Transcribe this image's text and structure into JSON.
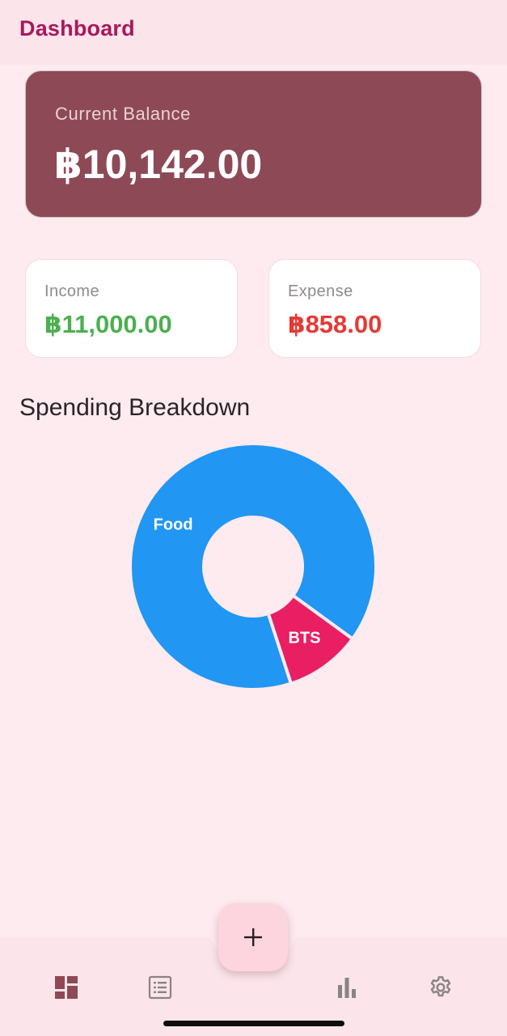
{
  "app_bar": {
    "title": "Dashboard"
  },
  "balance": {
    "label": "Current Balance",
    "amount": "฿10,142.00"
  },
  "income": {
    "label": "Income",
    "amount": "฿11,000.00"
  },
  "expense": {
    "label": "Expense",
    "amount": "฿858.00"
  },
  "spending": {
    "title": "Spending Breakdown"
  },
  "chart_data": {
    "type": "pie",
    "donut": true,
    "slices": [
      {
        "label": "Food",
        "fraction": 0.9,
        "color": "#2196f3"
      },
      {
        "label": "BTS",
        "fraction": 0.1,
        "color": "#e91e63"
      }
    ]
  },
  "colors": {
    "brand": "#a8195b",
    "balance_card": "#8e4956",
    "income": "#4caf50",
    "expense": "#e53935",
    "background": "#fdebf0"
  },
  "bottom_nav": {
    "items": [
      {
        "icon": "dashboard-icon",
        "active": true
      },
      {
        "icon": "transactions-list-icon",
        "active": false
      },
      {
        "icon": "bar-chart-icon",
        "active": false
      },
      {
        "icon": "settings-gear-icon",
        "active": false
      }
    ],
    "fab_icon": "plus-icon"
  }
}
